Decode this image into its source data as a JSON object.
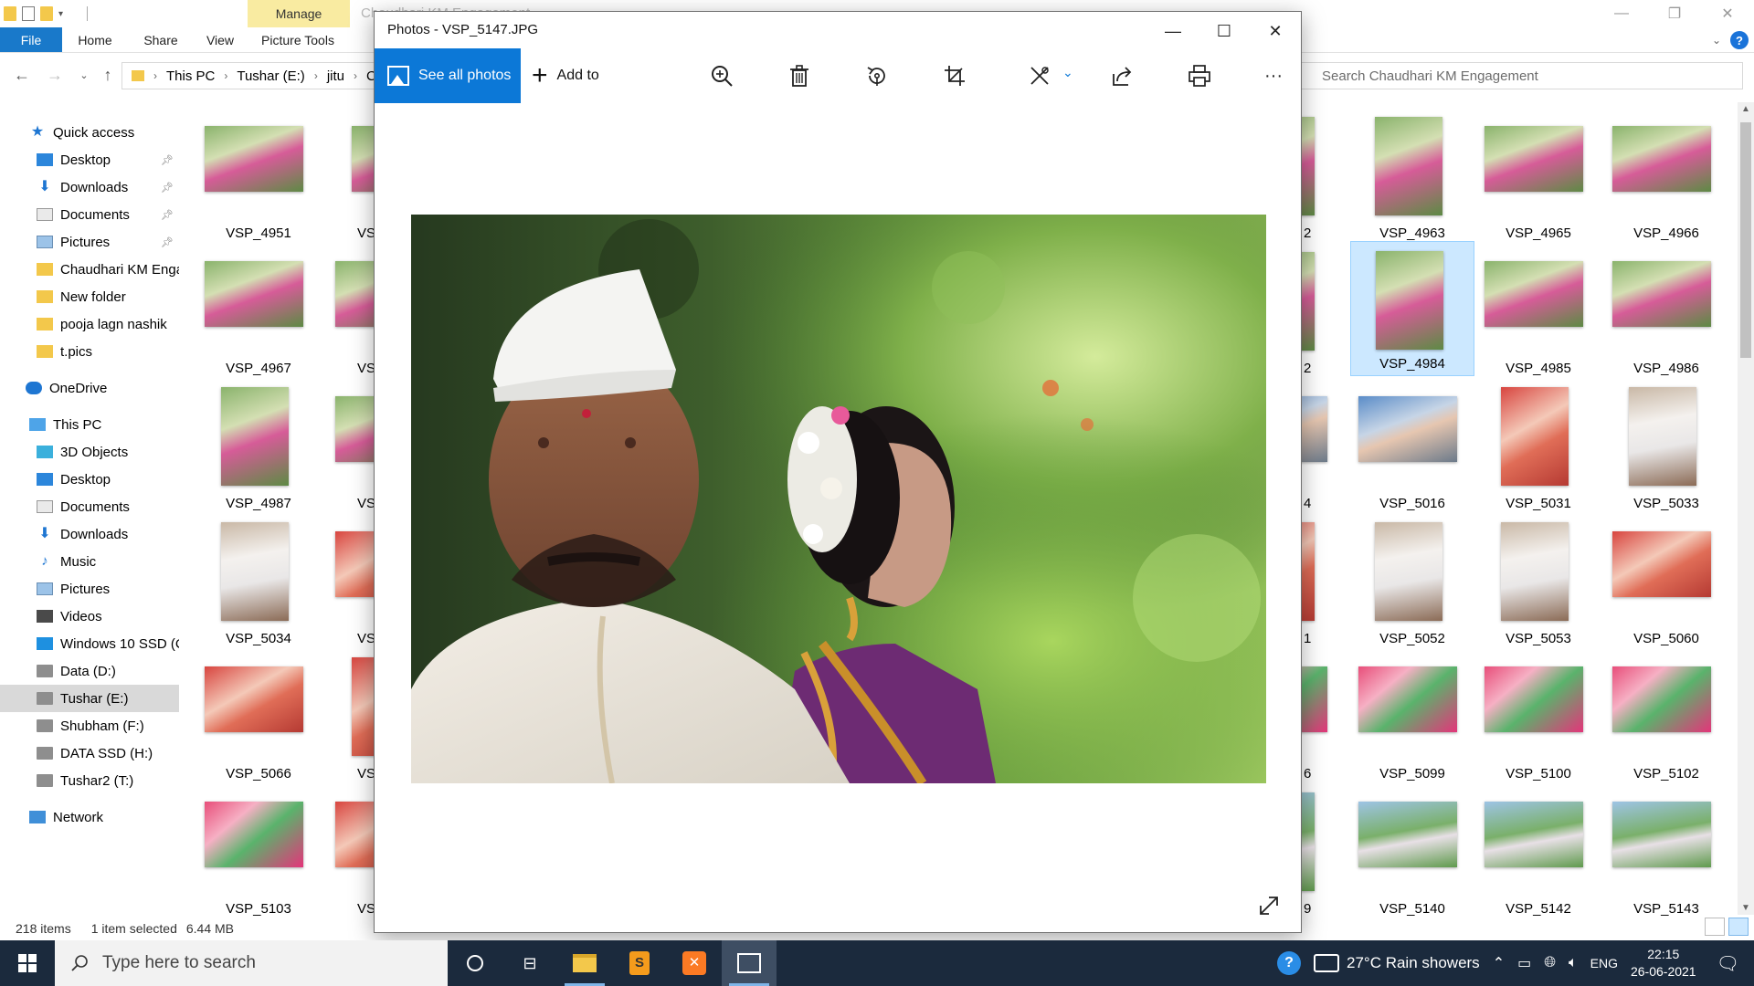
{
  "explorer": {
    "ribbon_context": "Manage",
    "window_title_partial": "Chaudhari KM Engagement",
    "tabs": [
      "File",
      "Home",
      "Share",
      "View",
      "Picture Tools"
    ],
    "breadcrumb": [
      "This PC",
      "Tushar (E:)",
      "jitu",
      "C"
    ],
    "search_placeholder": "Search Chaudhari KM Engagement",
    "nav": {
      "quick_access": "Quick access",
      "quick_items": [
        "Desktop",
        "Downloads",
        "Documents",
        "Pictures",
        "Chaudhari KM Enga",
        "New folder",
        "pooja lagn nashik",
        "t.pics"
      ],
      "onedrive": "OneDrive",
      "this_pc": "This PC",
      "pc_items": [
        "3D Objects",
        "Desktop",
        "Documents",
        "Downloads",
        "Music",
        "Pictures",
        "Videos",
        "Windows 10 SSD (C",
        "Data (D:)",
        "Tushar (E:)",
        "Shubham (F:)",
        "DATA SSD (H:)",
        "Tushar2 (T:)"
      ],
      "network": "Network"
    },
    "thumbs_left": [
      "VSP_4951",
      "VSP_4967",
      "VSP_4987",
      "VSP_5034",
      "VSP_5066",
      "VSP_5103"
    ],
    "thumbs_col2_partial": [
      "VS",
      "VS",
      "VS",
      "VS",
      "VS",
      "VS"
    ],
    "thumbs_col3_partial": [
      "2",
      "2",
      "4",
      "1",
      "6",
      "9"
    ],
    "thumbs_right": [
      [
        "VSP_4963",
        "VSP_4965",
        "VSP_4966"
      ],
      [
        "VSP_4984",
        "VSP_4985",
        "VSP_4986"
      ],
      [
        "VSP_5016",
        "VSP_5031",
        "VSP_5033"
      ],
      [
        "VSP_5052",
        "VSP_5053",
        "VSP_5060"
      ],
      [
        "VSP_5099",
        "VSP_5100",
        "VSP_5102"
      ],
      [
        "VSP_5140",
        "VSP_5142",
        "VSP_5143"
      ]
    ],
    "selected_thumb": "VSP_4984",
    "status": {
      "count": "218 items",
      "selection": "1 item selected",
      "size": "6.44 MB"
    }
  },
  "photos": {
    "title": "Photos - VSP_5147.JPG",
    "see_all": "See all photos",
    "add_to": "Add to",
    "tools": [
      "zoom-icon",
      "delete-icon",
      "rotate-icon",
      "crop-icon",
      "edit-icon",
      "share-icon",
      "print-icon",
      "more-icon"
    ],
    "more_label": "···"
  },
  "taskbar": {
    "search_placeholder": "Type here to search",
    "weather": "27°C  Rain showers",
    "language": "ENG",
    "time": "22:15",
    "date": "26-06-2021"
  }
}
